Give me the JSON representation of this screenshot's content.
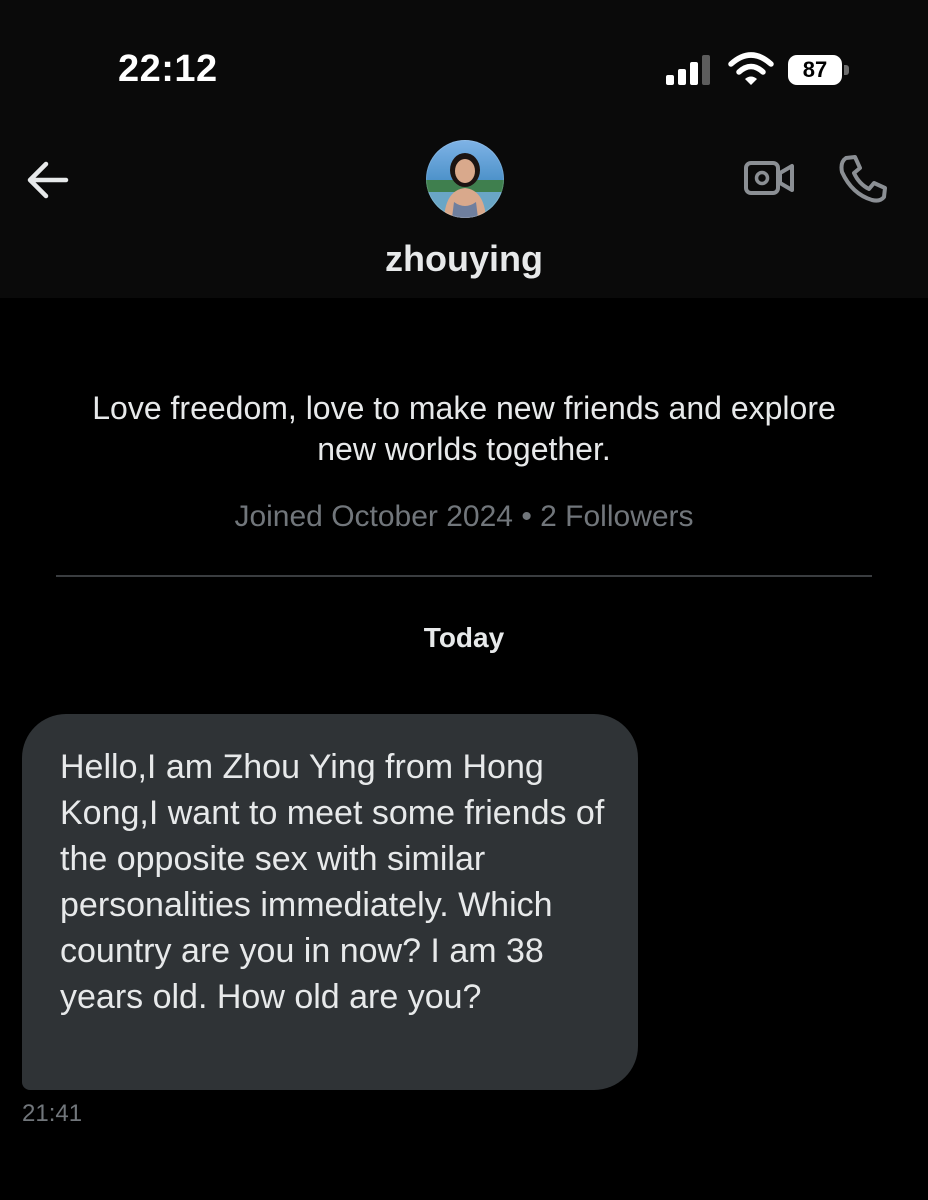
{
  "status_bar": {
    "time": "22:12",
    "battery_level": "87",
    "icons": [
      "signal-icon",
      "wifi-icon",
      "battery-icon"
    ]
  },
  "header": {
    "name": "zhouying",
    "icons": [
      "back-arrow-icon",
      "video-camera-icon",
      "phone-icon"
    ]
  },
  "profile": {
    "bio": "Love freedom, love to make new friends and explore new worlds together.",
    "meta": "Joined October 2024 • 2 Followers"
  },
  "conversation": {
    "day_label": "Today",
    "messages": [
      {
        "text": "Hello,I am Zhou Ying from Hong Kong,I want to meet some friends of the opposite sex with similar personalities immediately. Which country are you in now? I am 38 years old. How old are you?",
        "time": "21:41"
      }
    ]
  },
  "colors": {
    "background": "#000000",
    "header_background": "#0a0a0a",
    "bubble": "#2f3336",
    "primary_text": "#e7e9ea",
    "secondary_text": "#71767b",
    "divider": "#3a3d40"
  }
}
